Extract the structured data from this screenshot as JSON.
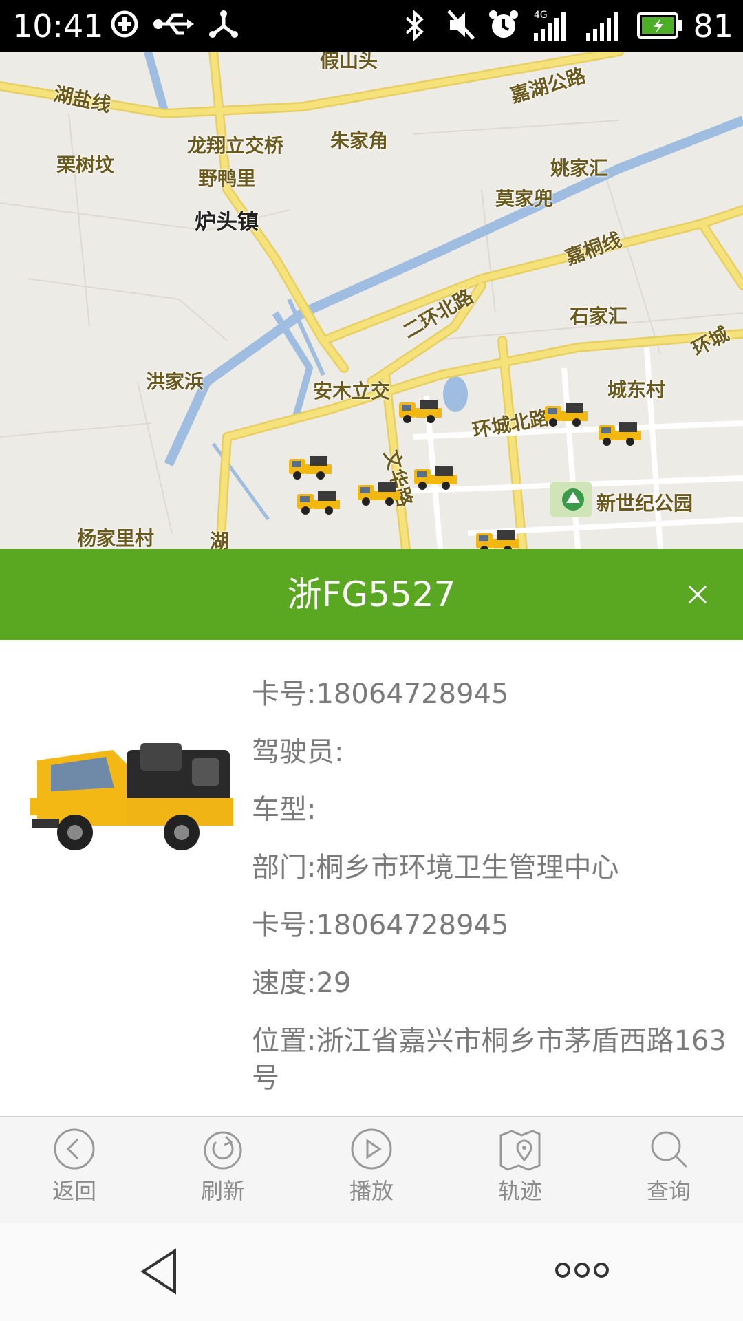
{
  "status_bar": {
    "time": "10:41",
    "battery": "81",
    "network": "4G"
  },
  "map": {
    "labels": {
      "jiashan": "假山头",
      "hubu_line": "湖盐线",
      "jiahu_road": "嘉湖公路",
      "lishu": "栗树坟",
      "longxiang": "龙翔立交桥",
      "zhujiajiao": "朱家角",
      "yaojiahui": "姚家汇",
      "yeyali": "野鸭里",
      "mojiadou": "莫家兜",
      "lutou": "炉头镇",
      "jiatong": "嘉桐线",
      "erhuan": "二环北路",
      "shijiahui": "石家汇",
      "huancheng_right": "环城",
      "hongjia": "洪家浜",
      "anmu": "安木立交",
      "chengdong": "城东村",
      "huancheng_north": "环城北路",
      "wenhua": "文华路",
      "park": "新世纪公园",
      "yangjiali": "杨家里村",
      "hu": "湖"
    }
  },
  "detail": {
    "plate": "浙FG5527",
    "rows": [
      {
        "label": "卡号:",
        "value": "18064728945"
      },
      {
        "label": "驾驶员:",
        "value": ""
      },
      {
        "label": "车型:",
        "value": ""
      },
      {
        "label": "部门:",
        "value": "桐乡市环境卫生管理中心"
      },
      {
        "label": "卡号:",
        "value": "18064728945"
      },
      {
        "label": "速度:",
        "value": "29"
      },
      {
        "label": "位置:",
        "value": "浙江省嘉兴市桐乡市茅盾西路163号"
      }
    ]
  },
  "toolbar": {
    "back": "返回",
    "refresh": "刷新",
    "play": "播放",
    "track": "轨迹",
    "query": "查询"
  },
  "colors": {
    "accent": "#5aa722",
    "road_yellow": "#f6e27a",
    "water": "#9fbde0"
  }
}
